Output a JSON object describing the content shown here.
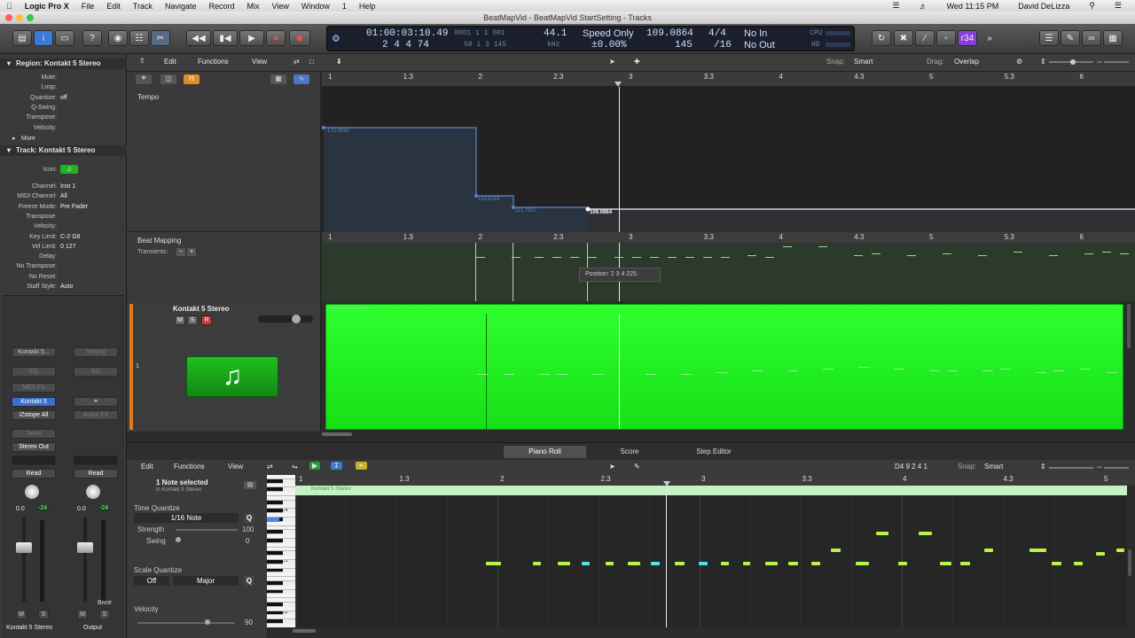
{
  "menubar": {
    "app": "Logic Pro X",
    "items": [
      "File",
      "Edit",
      "Track",
      "Navigate",
      "Record",
      "Mix",
      "View",
      "Window",
      "1",
      "Help"
    ],
    "clock": "Wed 11:15 PM",
    "user": "David DeLizza"
  },
  "window": {
    "title": "BeatMapVid - BeatMapVid StartSetting - Tracks"
  },
  "lcd": {
    "time": "01:00:03:10.49",
    "bars": "2  4  4   74",
    "ghost_top": "0001   1   1   001",
    "ghost_bottom": "58   1   3   145",
    "sample_rate": "44.1",
    "khz": "kHz",
    "mode": "Speed Only",
    "speed_pct": "±0.00%",
    "tempo": "109.0864",
    "tempo_small": "145",
    "sig": "4/4",
    "division": "/16",
    "in": "No In",
    "out": "No Out",
    "cpu": "CPU",
    "hd": "HD",
    "counter": "r34"
  },
  "inspector": {
    "region_title": "Region: Kontakt 5 Stereo",
    "region_rows": [
      {
        "label": "Mute:",
        "value": ""
      },
      {
        "label": "Loop:",
        "value": ""
      },
      {
        "label": "Quantize:",
        "value": "off"
      },
      {
        "label": "Q-Swing:",
        "value": ""
      },
      {
        "label": "Transpose:",
        "value": ""
      },
      {
        "label": "Velocity:",
        "value": ""
      }
    ],
    "more": "More",
    "track_title": "Track:  Kontakt 5 Stereo",
    "icon_label": "Icon:",
    "track_rows": [
      {
        "label": "Channel:",
        "value": "Inst 1"
      },
      {
        "label": "MIDI Channel:",
        "value": "All"
      },
      {
        "label": "Freeze Mode:",
        "value": "Pre Fader"
      },
      {
        "label": "Transpose:",
        "value": ""
      },
      {
        "label": "Velocity:",
        "value": ""
      },
      {
        "label": "Key Limit:",
        "value": "C-2      G8"
      },
      {
        "label": "Vel Limit:",
        "value": "0      127"
      },
      {
        "label": "Delay:",
        "value": ""
      },
      {
        "label": "No Transpose:",
        "value": ""
      },
      {
        "label": "No Reset:",
        "value": ""
      },
      {
        "label": "Staff Style:",
        "value": "Auto"
      }
    ],
    "strip1": {
      "name": "Kontakt 5...",
      "eq": "EQ",
      "midifx": "MIDI FX",
      "plugin1": "Kontakt 5",
      "plugin2": "iZotope All",
      "send": "Send",
      "out": "Stereo Out",
      "mode": "Read",
      "vol": "0.0",
      "pan": "-24",
      "m": "M",
      "s": "S",
      "footer": "Kontakt 5 Stereo"
    },
    "strip2": {
      "name": "Setting",
      "eq": "EQ",
      "audiofx": "Audio FX",
      "mode": "Read",
      "vol": "0.0",
      "pan": "-24",
      "m": "M",
      "s": "S",
      "bnce": "Bnce",
      "footer": "Output"
    }
  },
  "tracks": {
    "edit": "Edit",
    "functions": "Functions",
    "view": "View",
    "snap_label": "Snap:",
    "snap": "Smart",
    "drag_label": "Drag:",
    "drag": "Overlap",
    "ruler": [
      "1",
      "1.3",
      "2",
      "2.3",
      "3",
      "3.3",
      "4",
      "4.3",
      "5",
      "5.3",
      "6"
    ],
    "tempo_label": "Tempo",
    "tempo_axis": [
      "180",
      "160",
      "140",
      "120",
      "100"
    ],
    "tempo_points": [
      {
        "label": "172.0082"
      },
      {
        "label": "119.6318"
      },
      {
        "label": "111.7917"
      },
      {
        "label": "109.0864"
      }
    ],
    "beatmap_label": "Beat Mapping",
    "transients_label": "Transients:",
    "tooltip": "Position:   2 3 4 225.",
    "track_name": "Kontakt 5 Stereo",
    "track_num": "1",
    "m": "M",
    "s": "S",
    "r": "R",
    "region_name": "Kontakt 5 Stereo"
  },
  "editor": {
    "tabs": [
      "Piano Roll",
      "Score",
      "Step Editor"
    ],
    "edit": "Edit",
    "functions": "Functions",
    "view": "View",
    "position": "D4    9 2 4 1",
    "snap_label": "Snap:",
    "snap": "Smart",
    "selection": "1 Note selected",
    "selection_sub": "in Kontakt 5 Stereo",
    "time_quantize_label": "Time Quantize",
    "time_quantize": "1/16 Note",
    "strength_label": "Strength",
    "strength": "100",
    "swing_label": "Swing",
    "swing": "0",
    "scale_quantize_label": "Scale Quantize",
    "scale_off": "Off",
    "scale": "Major",
    "velocity_label": "Velocity",
    "velocity": "90",
    "ruler": [
      "1",
      "1.3",
      "2",
      "2.3",
      "3",
      "3.3",
      "4",
      "4.3",
      "5"
    ],
    "keys": [
      "C4",
      "C3",
      "C2"
    ],
    "region_name": "Kontakt 5 Stereo"
  },
  "colors": {
    "region": "#22f022",
    "note_green": "#b8f24a",
    "note_cyan": "#4fe3e3",
    "tempo_line": "#5b86c9"
  }
}
